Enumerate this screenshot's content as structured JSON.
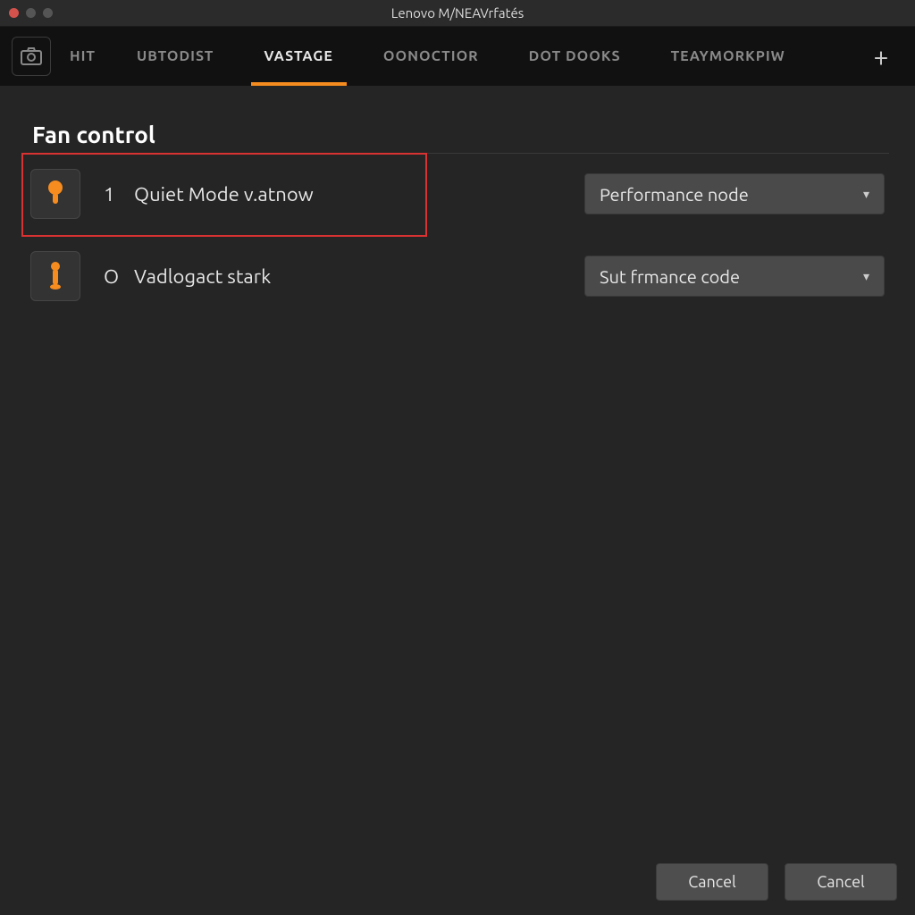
{
  "window": {
    "title": "Lenovo M/NEAVrfatés"
  },
  "tabs": {
    "items": [
      {
        "label": "HIT"
      },
      {
        "label": "UBTODIST"
      },
      {
        "label": "VASTAGE"
      },
      {
        "label": "OONOCTIOR"
      },
      {
        "label": "DOT DOOKS"
      },
      {
        "label": "TEAYMORKPIW"
      }
    ],
    "active_index": 2
  },
  "section": {
    "title": "Fan control"
  },
  "rows": [
    {
      "num": "1",
      "label": "Quiet Mode v.atnow",
      "dropdown": "Performance node"
    },
    {
      "num": "O",
      "label": "Vadlogact stark",
      "dropdown": "Sut frmance code"
    }
  ],
  "footer": {
    "buttons": [
      {
        "label": "Cancel"
      },
      {
        "label": "Cancel"
      }
    ]
  },
  "colors": {
    "accent": "#f68c1f",
    "highlight": "#d93232"
  }
}
